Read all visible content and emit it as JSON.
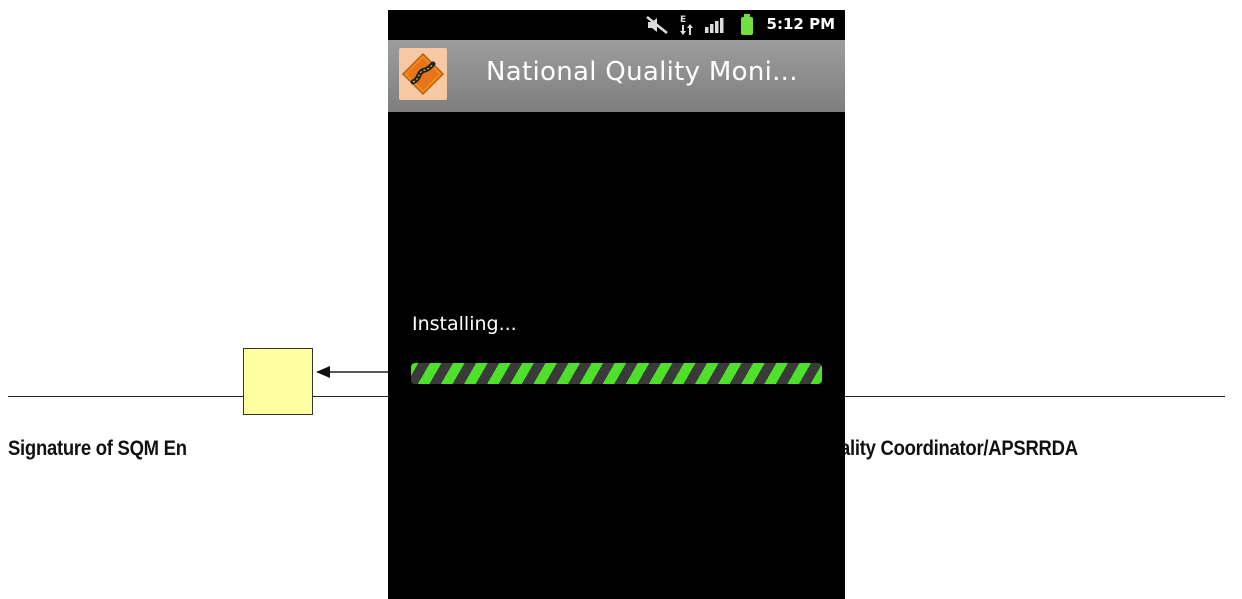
{
  "document": {
    "signature_left": "Signature of SQM En",
    "signature_right": "e Quality Coordinator/APSRRDA"
  },
  "phone": {
    "status_bar": {
      "time": "5:12 PM",
      "icons": [
        "mute-icon",
        "data-transfer-icon",
        "signal-icon",
        "battery-icon"
      ]
    },
    "app": {
      "title": "National Quality Moni...",
      "icon": "app-road-icon"
    },
    "install": {
      "label": "Installing...",
      "progress": 1.0,
      "progress_color": "#4ee02a"
    }
  }
}
